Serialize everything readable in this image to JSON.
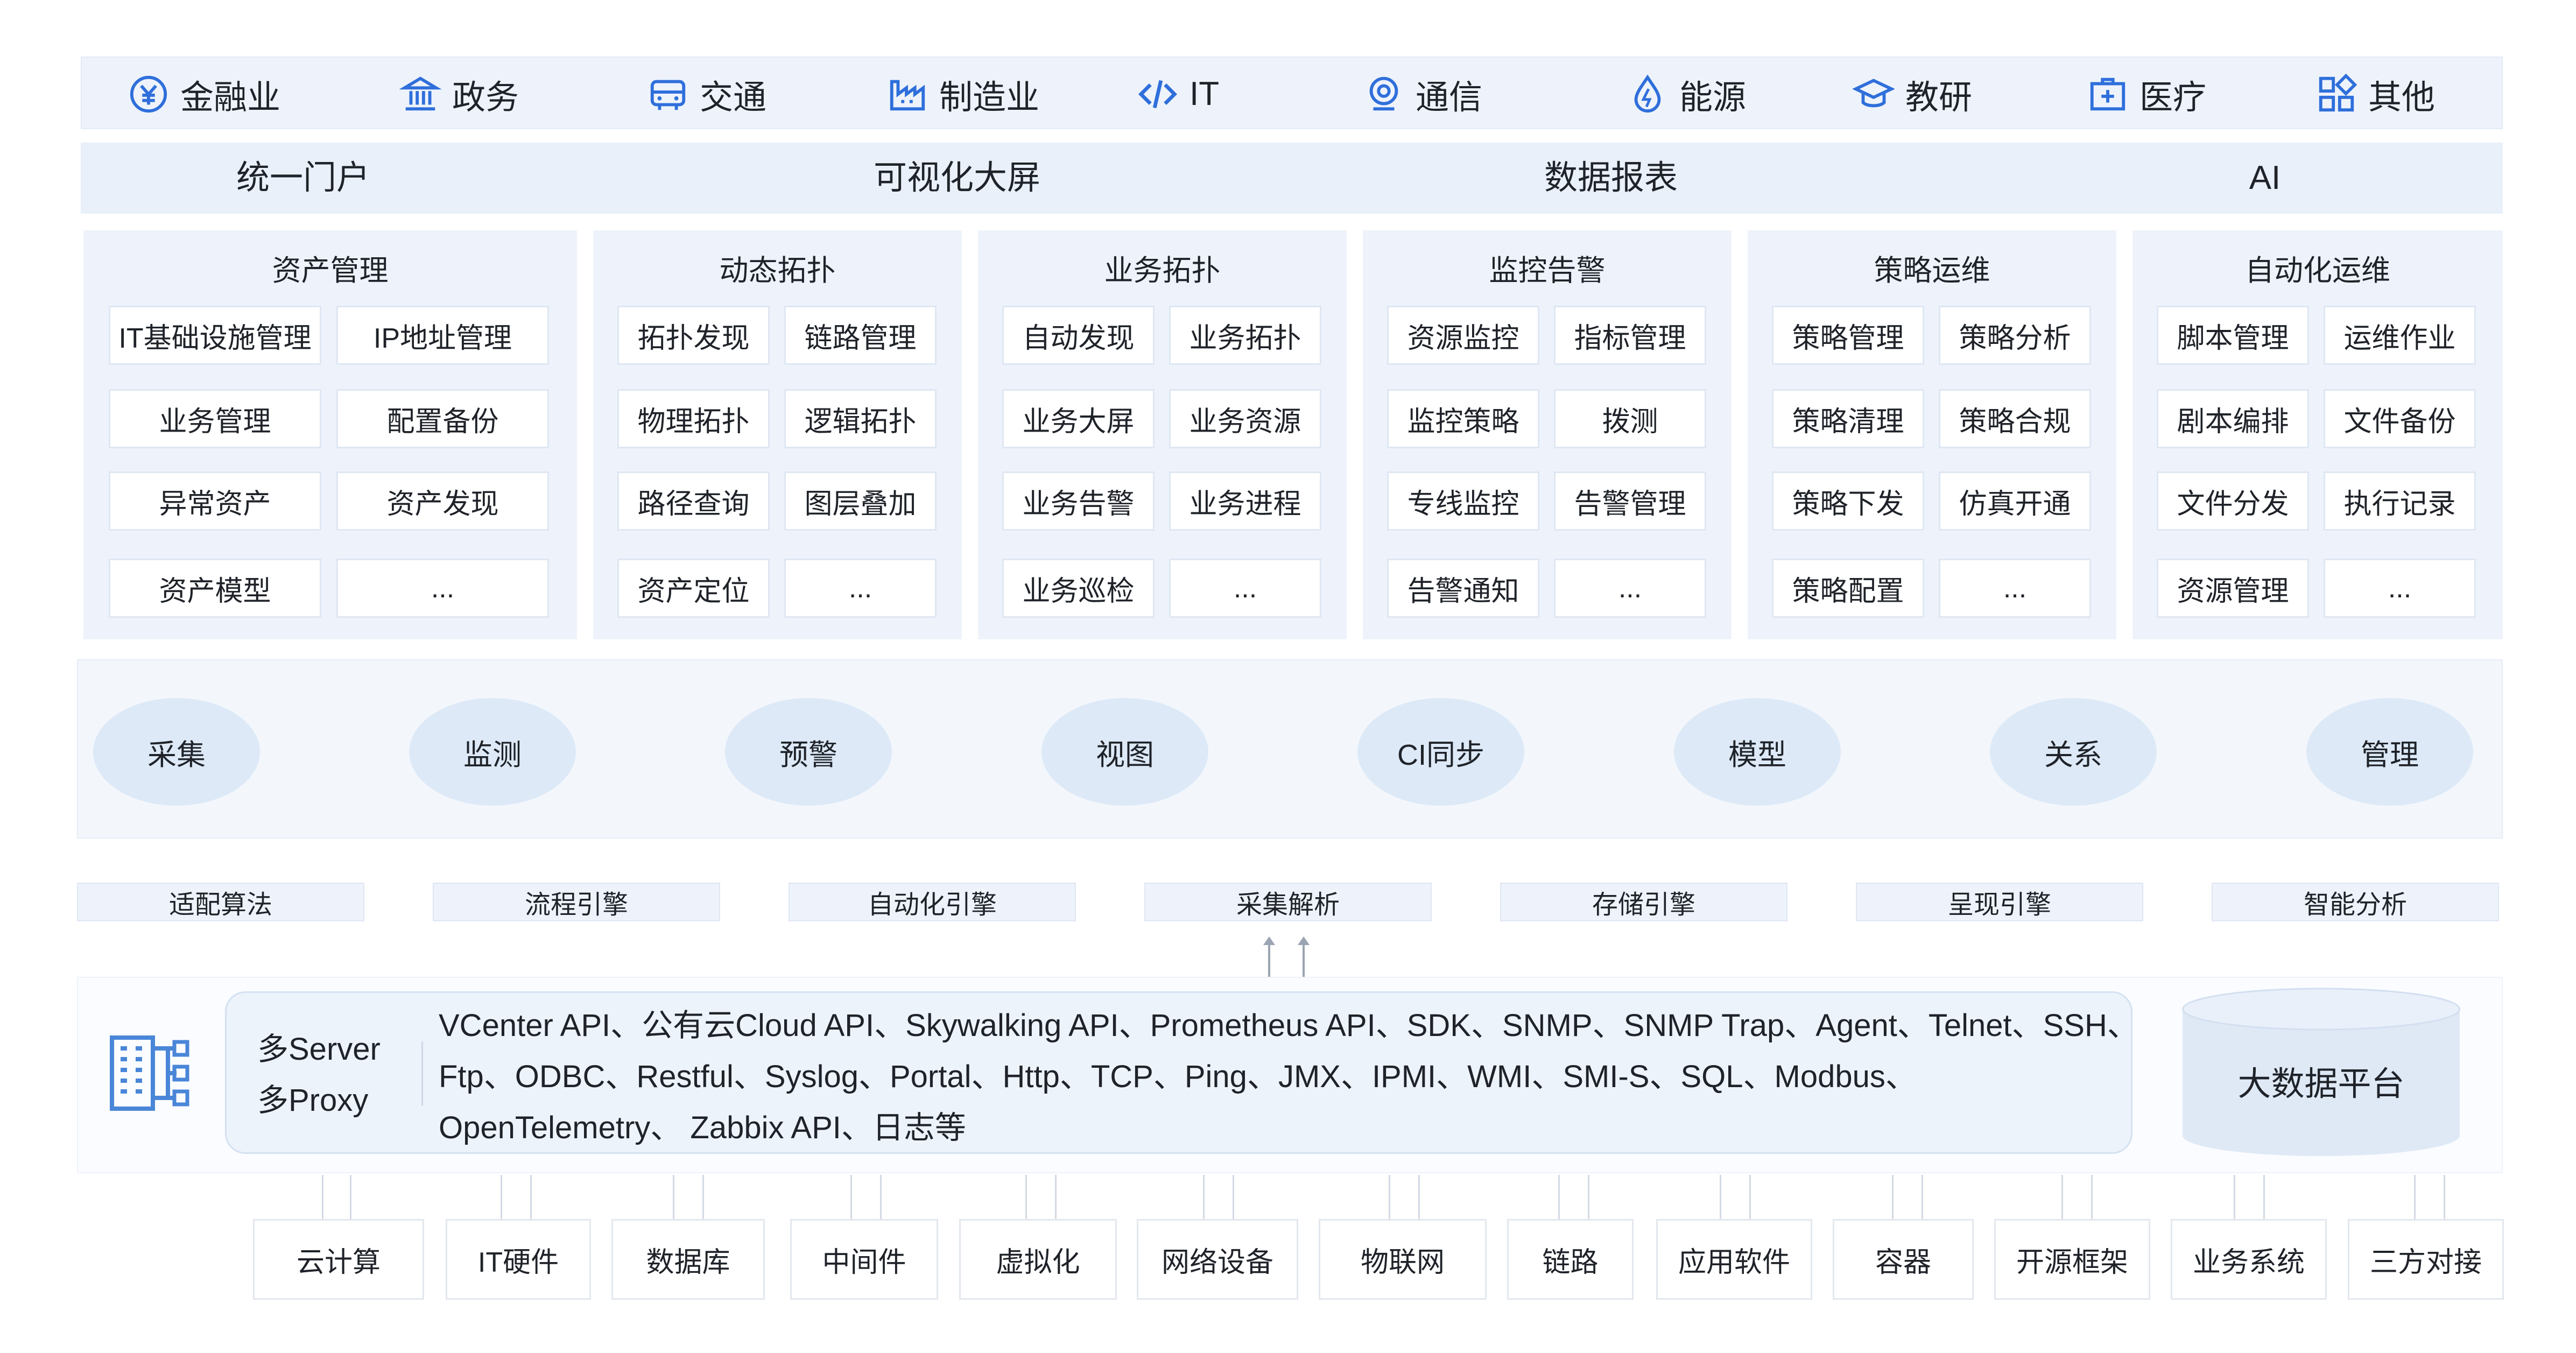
{
  "industries": [
    {
      "label": "金融业",
      "icon": "yuan-coin-icon"
    },
    {
      "label": "政务",
      "icon": "government-building-icon"
    },
    {
      "label": "交通",
      "icon": "bus-icon"
    },
    {
      "label": "制造业",
      "icon": "factory-icon"
    },
    {
      "label": "IT",
      "icon": "code-icon"
    },
    {
      "label": "通信",
      "icon": "signal-icon"
    },
    {
      "label": "能源",
      "icon": "energy-drop-icon"
    },
    {
      "label": "教研",
      "icon": "graduation-cap-icon"
    },
    {
      "label": "医疗",
      "icon": "medical-kit-icon"
    },
    {
      "label": "其他",
      "icon": "grid-apps-icon"
    }
  ],
  "portals": [
    "统一门户",
    "可视化大屏",
    "数据报表",
    "AI"
  ],
  "modules": [
    {
      "title": "资产管理",
      "items": [
        "IT基础设施管理",
        "IP地址管理",
        "业务管理",
        "配置备份",
        "异常资产",
        "资产发现",
        "资产模型",
        "..."
      ]
    },
    {
      "title": "动态拓扑",
      "items": [
        "拓扑发现",
        "链路管理",
        "物理拓扑",
        "逻辑拓扑",
        "路径查询",
        "图层叠加",
        "资产定位",
        "..."
      ]
    },
    {
      "title": "业务拓扑",
      "items": [
        "自动发现",
        "业务拓扑",
        "业务大屏",
        "业务资源",
        "业务告警",
        "业务进程",
        "业务巡检",
        "..."
      ]
    },
    {
      "title": "监控告警",
      "items": [
        "资源监控",
        "指标管理",
        "监控策略",
        "拨测",
        "专线监控",
        "告警管理",
        "告警通知",
        "..."
      ]
    },
    {
      "title": "策略运维",
      "items": [
        "策略管理",
        "策略分析",
        "策略清理",
        "策略合规",
        "策略下发",
        "仿真开通",
        "策略配置",
        "..."
      ]
    },
    {
      "title": "自动化运维",
      "items": [
        "脚本管理",
        "运维作业",
        "剧本编排",
        "文件备份",
        "文件分发",
        "执行记录",
        "资源管理",
        "..."
      ]
    }
  ],
  "capabilities": [
    "采集",
    "监测",
    "预警",
    "视图",
    "CI同步",
    "模型",
    "关系",
    "管理"
  ],
  "engines": [
    "适配算法",
    "流程引擎",
    "自动化引擎",
    "采集解析",
    "存储引擎",
    "呈现引擎",
    "智能分析"
  ],
  "collection": {
    "server_label": "多Server",
    "proxy_label": "多Proxy",
    "protocol_lines": [
      "VCenter API、公有云Cloud API、Skywalking API、Prometheus API、SDK、SNMP、SNMP Trap、Agent、Telnet、SSH、",
      "Ftp、ODBC、Restful、Syslog、Portal、Http、TCP、Ping、JMX、IPMI、WMI、SMI-S、SQL、Modbus、",
      "OpenTelemetry、 Zabbix API、日志等"
    ],
    "bigdata_label": "大数据平台",
    "server_icon": "server-cluster-icon"
  },
  "sources": [
    "云计算",
    "IT硬件",
    "数据库",
    "中间件",
    "虚拟化",
    "网络设备",
    "物联网",
    "链路",
    "应用软件",
    "容器",
    "开源框架",
    "业务系统",
    "三方对接"
  ],
  "colors": {
    "accent": "#2f6fdb",
    "panel": "#eef3fb",
    "capability": "#dde9f7"
  }
}
